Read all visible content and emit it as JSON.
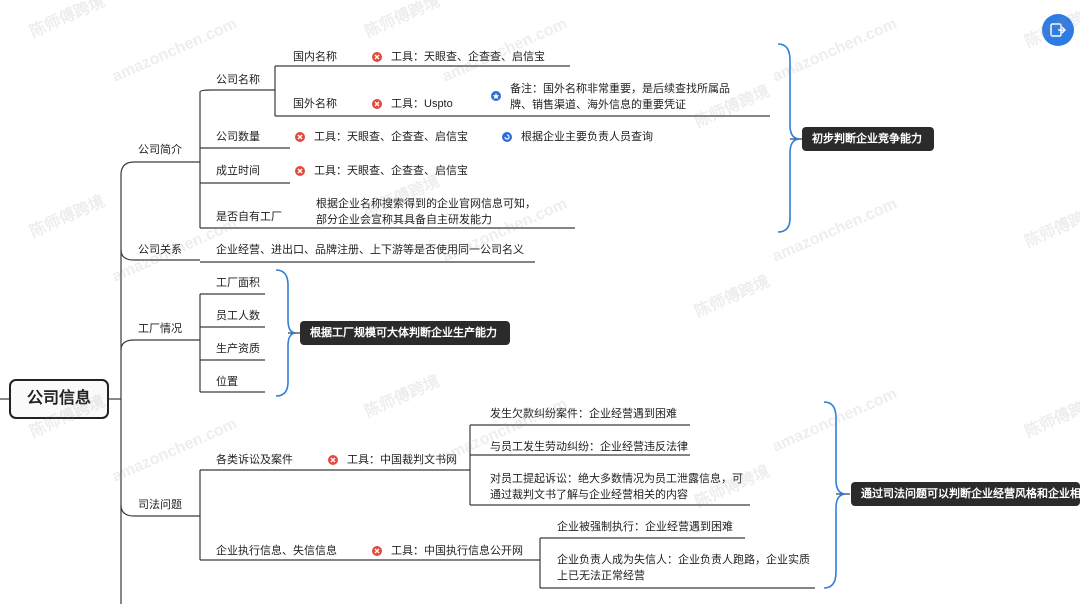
{
  "root": {
    "label": "公司信息"
  },
  "branches": {
    "intro": "公司简介",
    "relation": "公司关系",
    "factory": "工厂情况",
    "legal": "司法问题"
  },
  "intro": {
    "name": "公司名称",
    "domestic": "国内名称",
    "domestic_tool": "工具：天眼查、企查查、启信宝",
    "foreign": "国外名称",
    "foreign_tool": "工具：Uspto",
    "foreign_note": "备注：国外名称非常重要，是后续查找所属品牌、销售渠道、海外信息的重要凭证",
    "count": "公司数量",
    "count_tool": "工具：天眼查、企查查、启信宝",
    "count_note": "根据企业主要负责人员查询",
    "founded": "成立时间",
    "founded_tool": "工具：天眼查、企查查、启信宝",
    "own_factory": "是否自有工厂",
    "own_factory_note": "根据企业名称搜索得到的企业官网信息可知，部分企业会宣称其具备自主研发能力",
    "summary": "初步判断企业竞争能力"
  },
  "relation": {
    "text": "企业经营、进出口、品牌注册、上下游等是否使用同一公司名义"
  },
  "factory": {
    "area": "工厂面积",
    "staff": "员工人数",
    "qualification": "生产资质",
    "location": "位置",
    "summary": "根据工厂规模可大体判断企业生产能力"
  },
  "legal": {
    "lawsuits": "各类诉讼及案件",
    "lawsuits_tool": "工具：中国裁判文书网",
    "l1": "发生欠款纠纷案件：企业经营遇到困难",
    "l2": "与员工发生劳动纠纷：企业经营违反法律",
    "l3": "对员工提起诉讼：绝大多数情况为员工泄露信息，可通过裁判文书了解与企业经营相关的内容",
    "exec": "企业执行信息、失信信息",
    "exec_tool": "工具：中国执行信息公开网",
    "e1": "企业被强制执行：企业经营遇到困难",
    "e2": "企业负责人成为失信人：企业负责人跑路，企业实质上已无法正常经营",
    "summary": "通过司法问题可以判断企业经营风格和企业相"
  },
  "watermark": {
    "brand": "陈师傅跨境",
    "site": "amazonchen.com"
  },
  "colors": {
    "line": "#3a3a3a",
    "brace": "#2f7fd6",
    "tool": "#e5493d",
    "note": "#2c6fd7",
    "summary": "#2b2b2b"
  }
}
